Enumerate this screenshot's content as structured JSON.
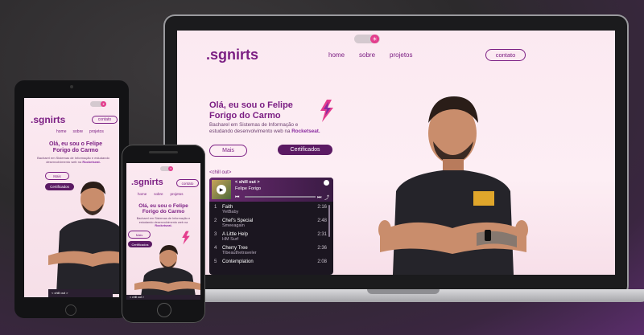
{
  "site": {
    "logo": ".sgnirts",
    "nav": [
      "home",
      "sobre",
      "projetos"
    ],
    "contact_button": "contato",
    "hero_title_line1": "Olá, eu sou o Felipe",
    "hero_title_line2": "Forigo do Carmo",
    "hero_sub_line1": "Bacharel em Sistemas de Informação e",
    "hero_sub_line2": "estudando desenvolvimento web na",
    "hero_sub_highlight": "Rocketseat.",
    "more_button": "Mais",
    "certificates_button": "Certificados",
    "chillout_label": "<chill out>"
  },
  "player": {
    "playlist_title": "< shill out >",
    "playlist_artist": "Felipe Forigo",
    "tracks": [
      {
        "num": "1",
        "title": "Faith",
        "artist": "YetBaby",
        "dur": "2:16"
      },
      {
        "num": "2",
        "title": "Chef's Special",
        "artist": "Smeeagain",
        "dur": "2:48"
      },
      {
        "num": "3",
        "title": "A Little Help",
        "artist": "HM Surf",
        "dur": "2:31"
      },
      {
        "num": "4",
        "title": "Cherry Tree",
        "artist": "Tibeauthetraveler",
        "dur": "2:36"
      },
      {
        "num": "5",
        "title": "Contemplation",
        "artist": "",
        "dur": "2:08"
      }
    ]
  },
  "tablet": {
    "logo": ".sgnirts",
    "contact_button": "contato",
    "nav": [
      "home",
      "sobre",
      "projetos"
    ],
    "hero_title_line1": "Olá, eu sou o Felipe",
    "hero_title_line2": "Forigo do Carmo",
    "hero_sub": "Bacharel em Sistemas de Informação e estudando desenvolvimento web na",
    "hero_sub_highlight": "Rocketseat.",
    "more_button": "Mais",
    "certificates_button": "Certificados",
    "chillout_label": "< chill out >"
  },
  "phone": {
    "logo": ".sgnirts",
    "contact_button": "contato",
    "nav": [
      "home",
      "sobre",
      "projetos"
    ],
    "hero_title_line1": "Olá, eu sou o Felipe",
    "hero_title_line2": "Forigo do Carmo",
    "hero_sub": "Bacharel em Sistemas de Informação e estudando desenvolvimento web na",
    "hero_sub_highlight": "Rocketseat.",
    "more_button": "Mais",
    "certificates_button": "Certificados",
    "chillout_label": "< chill out >"
  },
  "colors": {
    "brand": "#7b1e83",
    "button_fill": "#5b1a63",
    "toggle_knob": "#e43d8d"
  }
}
